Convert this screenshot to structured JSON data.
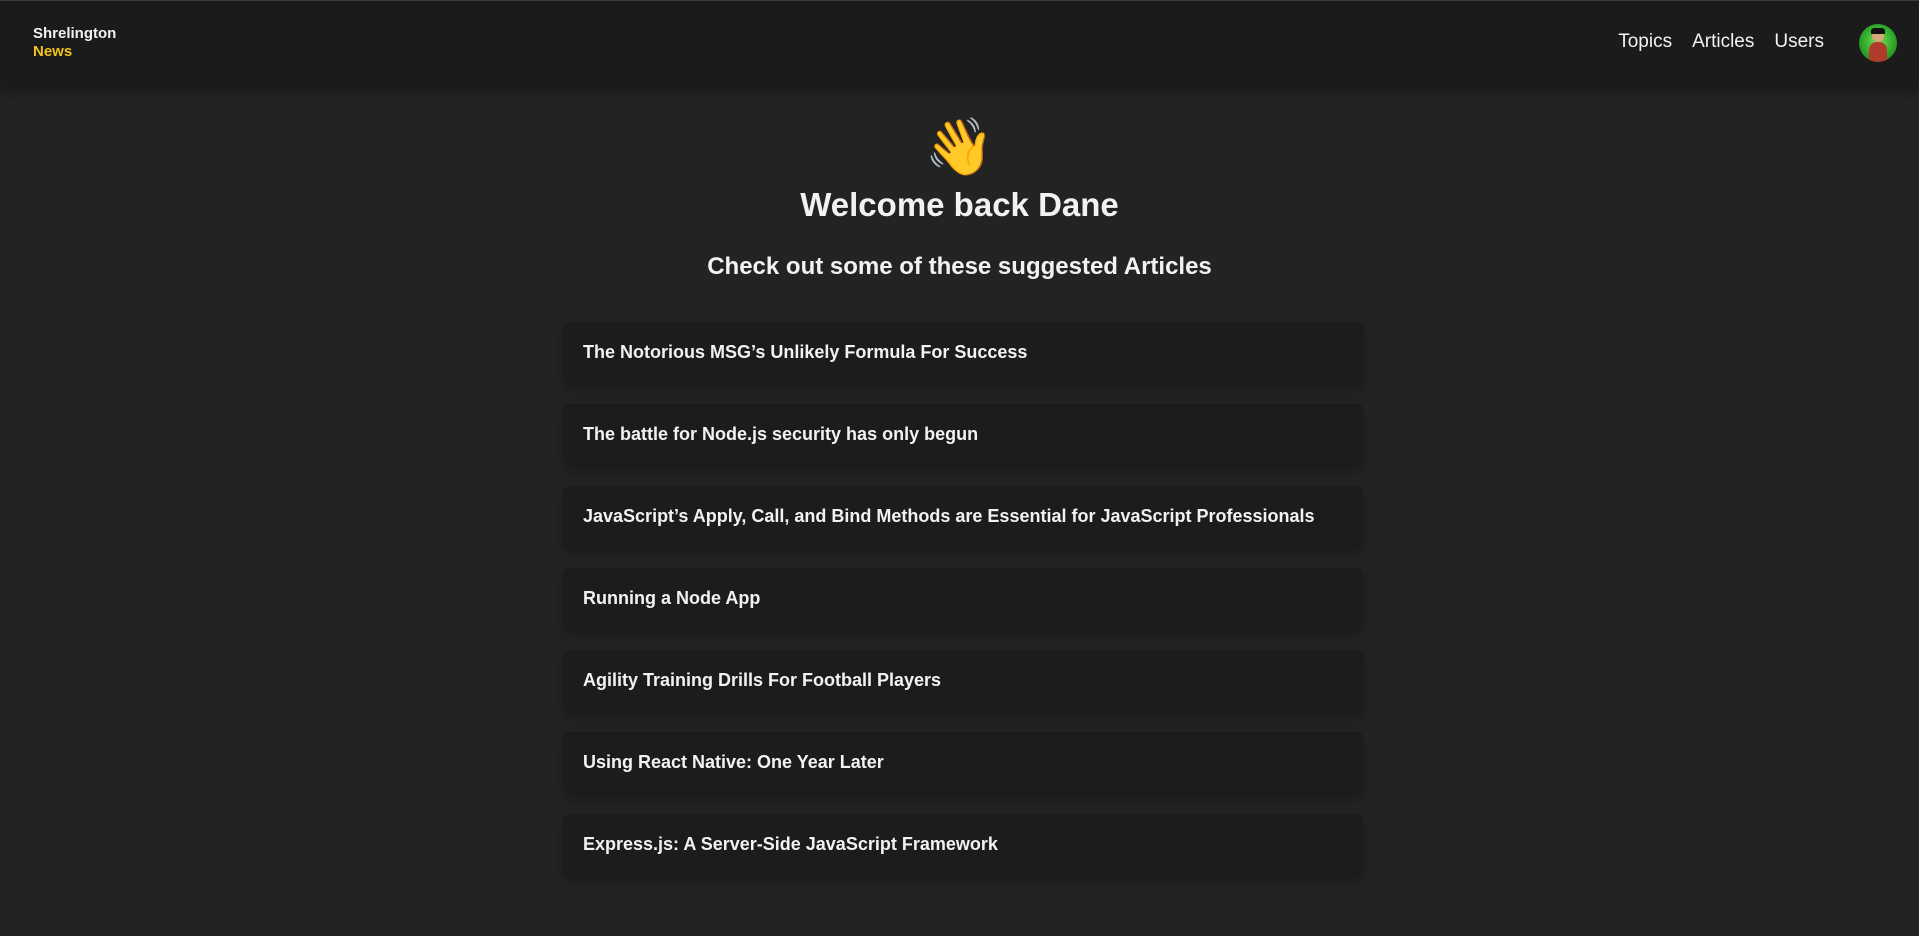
{
  "header": {
    "brand_line1": "Shrelington",
    "brand_line2": "News",
    "nav": [
      "Topics",
      "Articles",
      "Users"
    ]
  },
  "main": {
    "wave_emoji": "👋",
    "welcome": "Welcome back Dane",
    "subtitle": "Check out some of these suggested Articles",
    "articles": [
      "The Notorious MSG’s Unlikely Formula For Success",
      "The battle for Node.js security has only begun",
      "JavaScript’s Apply, Call, and Bind Methods are Essential for JavaScript Professionals",
      "Running a Node App",
      "Agility Training Drills For Football Players",
      "Using React Native: One Year Later",
      "Express.js: A Server-Side JavaScript Framework"
    ]
  },
  "colors": {
    "background": "#232323",
    "header": "#1b1b1b",
    "card": "#1c1c1c",
    "accent": "#f0c419"
  }
}
